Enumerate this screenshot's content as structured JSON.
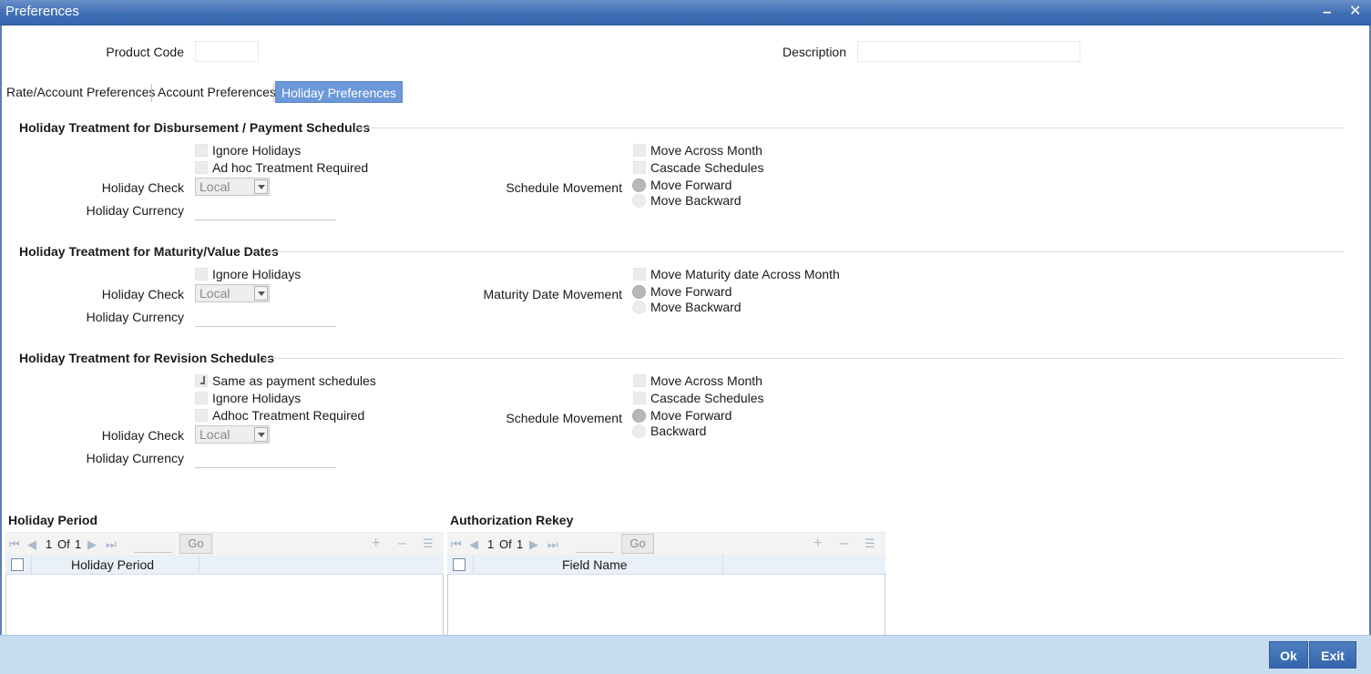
{
  "window": {
    "title": "Preferences",
    "minimize_glyph": "–",
    "close_glyph": "✕"
  },
  "header": {
    "product_code_label": "Product Code",
    "product_code_value": "",
    "description_label": "Description",
    "description_value": ""
  },
  "tabs": [
    {
      "label": "Rate/Account Preferences",
      "active": false
    },
    {
      "label": "Account Preferences",
      "active": false
    },
    {
      "label": "Holiday Preferences",
      "active": true
    }
  ],
  "disbursement": {
    "title": "Holiday Treatment for Disbursement / Payment Schedules",
    "ignore_holidays": "Ignore Holidays",
    "adhoc_treatment": "Ad hoc Treatment Required",
    "holiday_check_label": "Holiday Check",
    "holiday_check_value": "Local",
    "holiday_currency_label": "Holiday Currency",
    "holiday_currency_value": "",
    "schedule_movement_label": "Schedule Movement",
    "move_across_month": "Move Across Month",
    "cascade_schedules": "Cascade Schedules",
    "move_forward": "Move Forward",
    "move_backward": "Move Backward"
  },
  "maturity": {
    "title": "Holiday Treatment for Maturity/Value Dates",
    "ignore_holidays": "Ignore Holidays",
    "holiday_check_label": "Holiday Check",
    "holiday_check_value": "Local",
    "holiday_currency_label": "Holiday Currency",
    "holiday_currency_value": "",
    "maturity_date_movement_label": "Maturity Date Movement",
    "move_maturity_across_month": "Move Maturity date Across Month",
    "move_forward": "Move Forward",
    "move_backward": "Move Backward"
  },
  "revision": {
    "title": "Holiday Treatment for Revision Schedules",
    "same_as_payment": "Same as payment schedules",
    "ignore_holidays": "Ignore Holidays",
    "adhoc_treatment": "Adhoc Treatment Required",
    "holiday_check_label": "Holiday Check",
    "holiday_check_value": "Local",
    "holiday_currency_label": "Holiday Currency",
    "holiday_currency_value": "",
    "schedule_movement_label": "Schedule Movement",
    "move_across_month": "Move Across Month",
    "cascade_schedules": "Cascade Schedules",
    "move_forward": "Move Forward",
    "backward": "Backward"
  },
  "holiday_period_grid": {
    "title": "Holiday Period",
    "page_current": "1",
    "page_of": "Of",
    "page_total": "1",
    "go_label": "Go",
    "column": "Holiday Period"
  },
  "auth_rekey_grid": {
    "title": "Authorization Rekey",
    "page_current": "1",
    "page_of": "Of",
    "page_total": "1",
    "go_label": "Go",
    "column": "Field Name"
  },
  "footer": {
    "ok_label": "Ok",
    "exit_label": "Exit"
  },
  "colors": {
    "titlebar": "#3f6fb4",
    "active_tab": "#6b98d8",
    "footer": "#c6dcf0",
    "button": "#3465ad"
  }
}
